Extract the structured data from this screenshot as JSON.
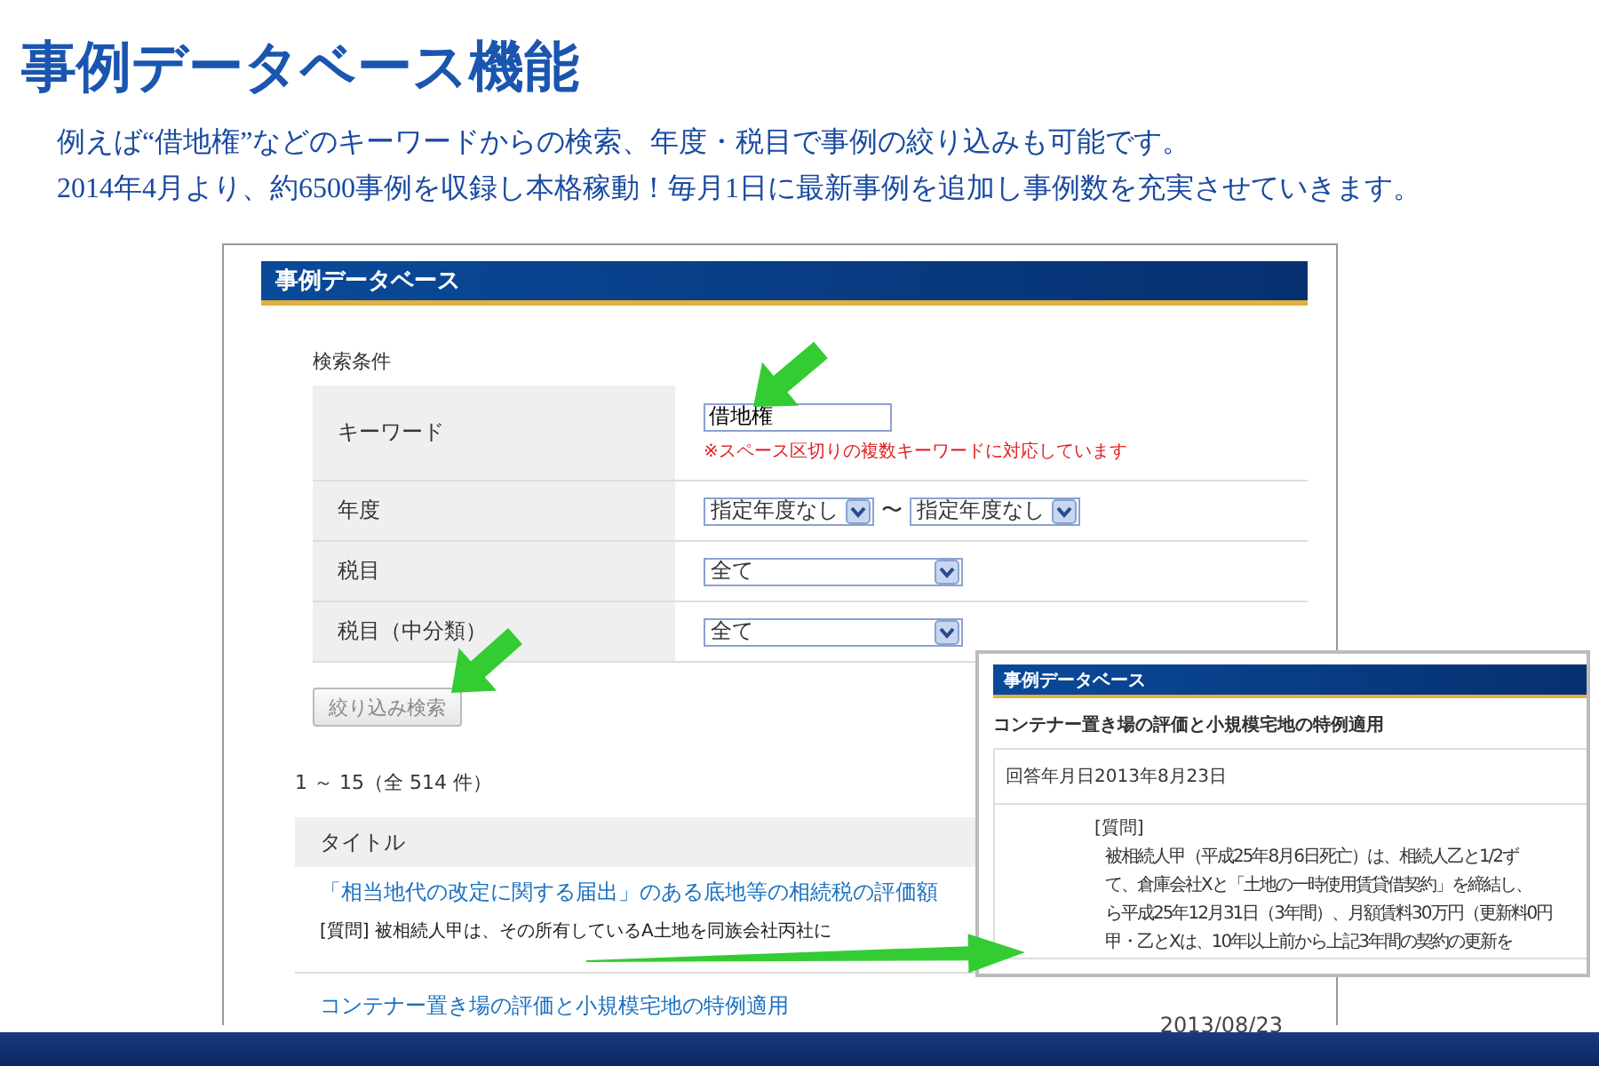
{
  "page": {
    "title": "事例データベース機能",
    "description": [
      "例えば“借地権”などのキーワードからの検索、年度・税目で事例の絞り込みも可能です。",
      "2014年4月より、約6500事例を収録し本格稼動！毎月1日に最新事例を追加し事例数を充実させていきます。"
    ]
  },
  "database_panel": {
    "title": "事例データベース",
    "search_section_label": "検索条件",
    "fields": [
      {
        "kind": "text",
        "label": "キーワード",
        "value": "借地権",
        "note": "※スペース区切りの複数キーワードに対応しています"
      },
      {
        "kind": "range",
        "label": "年度",
        "from": "指定年度なし",
        "separator": "〜",
        "to": "指定年度なし"
      },
      {
        "kind": "select",
        "label": "税目",
        "value": "全て"
      },
      {
        "kind": "select",
        "label": "税目（中分類）",
        "value": "全て"
      }
    ],
    "search_button": "絞り込み検索",
    "result_count": "1 ～ 15（全 514 件）",
    "table": {
      "column": "タイトル",
      "rows": [
        {
          "title": "「相当地代の改定に関する届出」のある底地等の相続税の評価額",
          "excerpt": "[質問] 被相続人甲は、その所有しているA土地を同族会社丙社に"
        },
        {
          "title": "コンテナー置き場の評価と小規模宅地の特例適用",
          "date": "2013/08/23"
        }
      ]
    }
  },
  "detail_popup": {
    "title": "事例データベース",
    "case_title": "コンテナー置き場の評価と小規模宅地の特例適用",
    "answer_date_label": "回答年月日",
    "answer_date": "2013年8月23日",
    "question_heading": "[質問]",
    "question_lines": [
      "被相続人甲（平成25年8月6日死亡）は、相続人乙と1/2ず",
      "て、倉庫会社Xと「土地の一時使用賃貸借契約」を締結し、",
      "ら平成25年12月31日（3年間）、月額賃料30万円（更新料0円",
      "甲・乙とXは、10年以上前から上記3年間の契約の更新を"
    ]
  }
}
